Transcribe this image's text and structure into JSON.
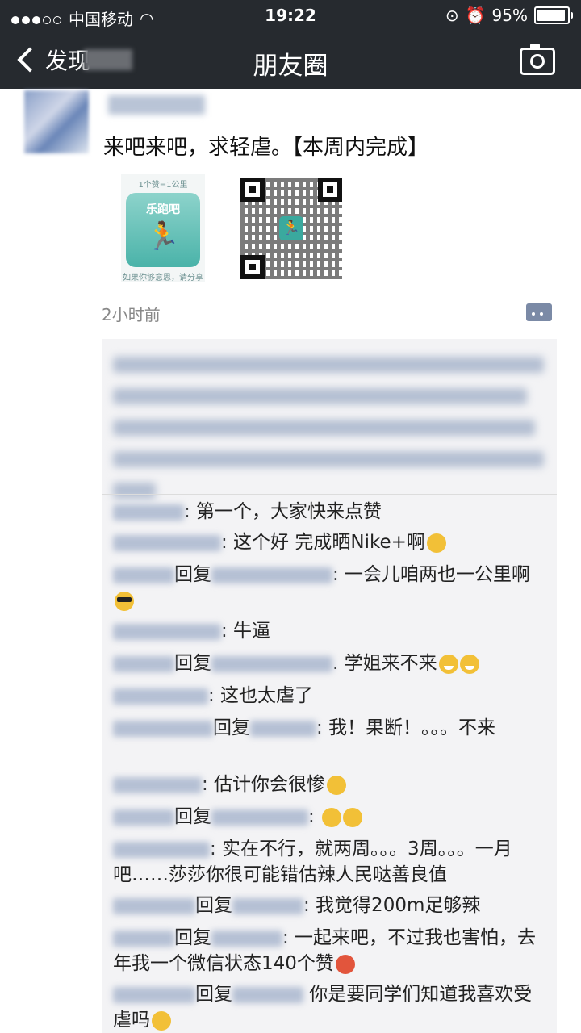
{
  "status_bar": {
    "carrier": "中国移动",
    "time": "19:22",
    "battery_percent": "95%",
    "battery_level": 0.95
  },
  "nav": {
    "back_label": "发现",
    "title": "朋友圈"
  },
  "post": {
    "text": "来吧来吧，求轻虐。【本周内完成】",
    "image_caption": "1个赞=1公里",
    "app_name": "乐跑吧",
    "image_footer": "如果你够意思，请分享",
    "timestamp": "2小时前"
  },
  "comments": [
    {
      "reply_label": "",
      "text": ": 第一个，大家快来点赞"
    },
    {
      "reply_label": "",
      "text": ": 这个好 完成晒Nike+啊"
    },
    {
      "reply_label": "回复",
      "text": ": 一会儿咱两也一公里啊"
    },
    {
      "reply_label": "",
      "text": ": 牛逼"
    },
    {
      "reply_label": "回复",
      "text": ". 学姐来不来"
    },
    {
      "reply_label": "",
      "text": ": 这也太虐了"
    },
    {
      "reply_label": "回复",
      "text": ": 我！果断！。。。不来"
    },
    {
      "reply_label": "",
      "text": ": 估计你会很惨"
    },
    {
      "reply_label": "回复",
      "text": ":"
    },
    {
      "reply_label": "",
      "text": ": 实在不行，就两周。。。3周。。。一月吧……莎莎你很可能错估辣人民哒善良值"
    },
    {
      "reply_label": "回复",
      "text": ": 我觉得200m足够辣"
    },
    {
      "reply_label": "回复",
      "text": ": 一起来吧，不过我也害怕，去年我一个微信状态140个赞"
    },
    {
      "reply_label": "回复",
      "text": " 你是要同学们知道我喜欢受虐吗"
    }
  ]
}
